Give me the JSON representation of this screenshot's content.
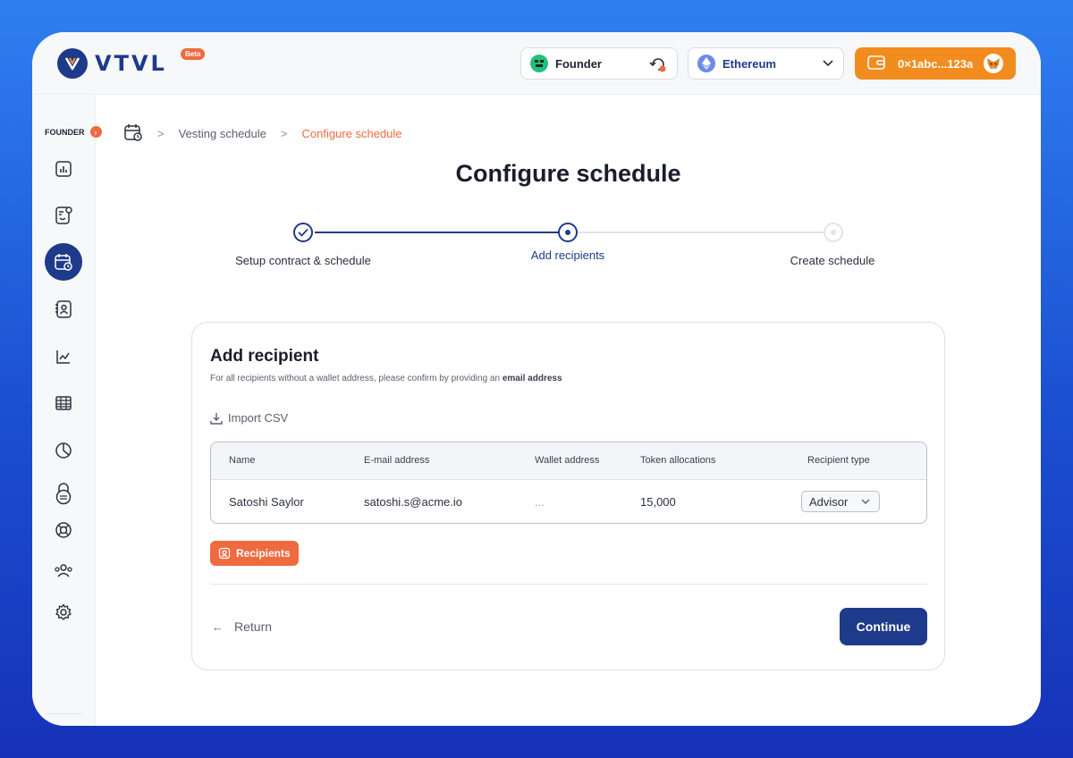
{
  "app": {
    "logo_text": "VTVL",
    "beta_badge": "Beta"
  },
  "header": {
    "role_selector": "Founder",
    "network_selector": "Ethereum",
    "wallet_address": "0×1abc...123a"
  },
  "sidebar": {
    "role_label": "FOUNDER",
    "items": [
      {
        "name": "dashboard",
        "icon": "bar-chart-icon",
        "active": false
      },
      {
        "name": "cap-table",
        "icon": "form-icon",
        "active": false
      },
      {
        "name": "vesting-schedule",
        "icon": "calendar-clock-icon",
        "active": true
      },
      {
        "name": "recipients",
        "icon": "contact-icon",
        "active": false
      },
      {
        "name": "analytics",
        "icon": "line-chart-icon",
        "active": false
      },
      {
        "name": "table",
        "icon": "grid-table-icon",
        "active": false
      },
      {
        "name": "reports",
        "icon": "pie-chart-icon",
        "active": false
      },
      {
        "name": "tokens",
        "icon": "lock-icon",
        "active": false
      },
      {
        "name": "support",
        "icon": "lifebuoy-icon",
        "active": false
      },
      {
        "name": "team",
        "icon": "team-icon",
        "active": false
      },
      {
        "name": "settings",
        "icon": "gear-icon",
        "active": false
      }
    ]
  },
  "breadcrumb": {
    "items": [
      "Vesting schedule",
      "Configure schedule"
    ]
  },
  "page": {
    "title": "Configure schedule"
  },
  "stepper": {
    "steps": [
      {
        "label": "Setup contract & schedule",
        "status": "done"
      },
      {
        "label": "Add recipients",
        "status": "current"
      },
      {
        "label": "Create schedule",
        "status": "todo"
      }
    ]
  },
  "card": {
    "title": "Add recipient",
    "subtitle_prefix": "For all recipients without a wallet address, please confirm by providing an ",
    "subtitle_bold": "email address",
    "import_label": "Import CSV",
    "table": {
      "headers": [
        "Name",
        "E-mail address",
        "Wallet address",
        "Token allocations",
        "Recipient type"
      ],
      "rows": [
        {
          "name": "Satoshi Saylor",
          "email": "satoshi.s@acme.io",
          "wallet": "...",
          "tokens": "15,000",
          "type": "Advisor"
        }
      ]
    },
    "recipients_button": "Recipients",
    "return_label": "Return",
    "continue_label": "Continue"
  },
  "colors": {
    "brand_navy": "#1e3a8a",
    "accent_orange": "#f06a3f",
    "wallet_orange": "#f28c1f",
    "background_blue": "#2f7ff0"
  }
}
